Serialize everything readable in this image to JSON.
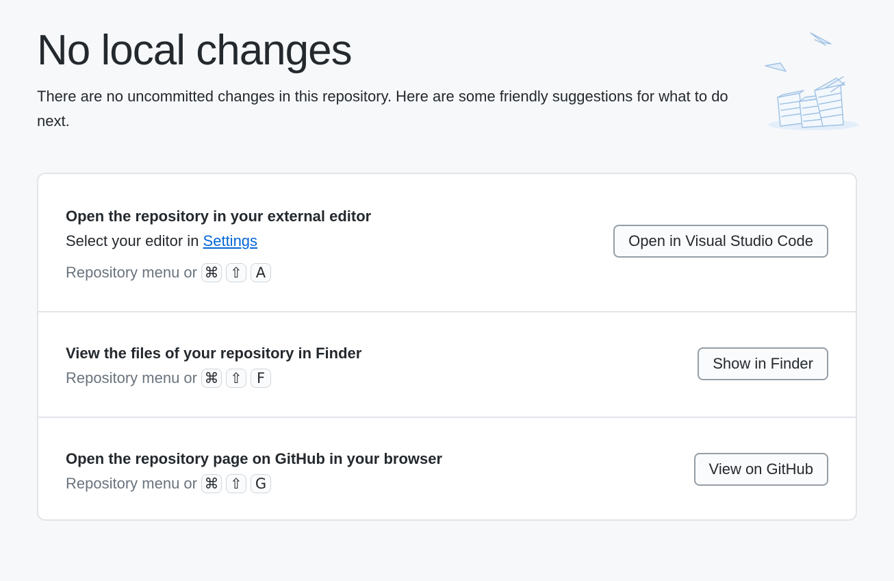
{
  "page": {
    "title": "No local changes",
    "description": "There are no uncommitted changes in this repository. Here are some friendly suggestions for what to do next."
  },
  "suggestions": [
    {
      "title": "Open the repository in your external editor",
      "subtitle_prefix": "Select your editor in ",
      "subtitle_link": "Settings",
      "shortcut_prefix": "Repository menu or",
      "keys": [
        "⌘",
        "⇧",
        "A"
      ],
      "button_label": "Open in Visual Studio Code"
    },
    {
      "title": "View the files of your repository in Finder",
      "shortcut_prefix": "Repository menu or",
      "keys": [
        "⌘",
        "⇧",
        "F"
      ],
      "button_label": "Show in Finder"
    },
    {
      "title": "Open the repository page on GitHub in your browser",
      "shortcut_prefix": "Repository menu or",
      "keys": [
        "⌘",
        "⇧",
        "G"
      ],
      "button_label": "View on GitHub"
    }
  ],
  "illustration": {
    "icon": "paper-stacks-illustration",
    "color": "#c8dcf0"
  },
  "colors": {
    "link": "#0366d6",
    "muted": "#6a737d",
    "border": "#e1e4e8"
  }
}
